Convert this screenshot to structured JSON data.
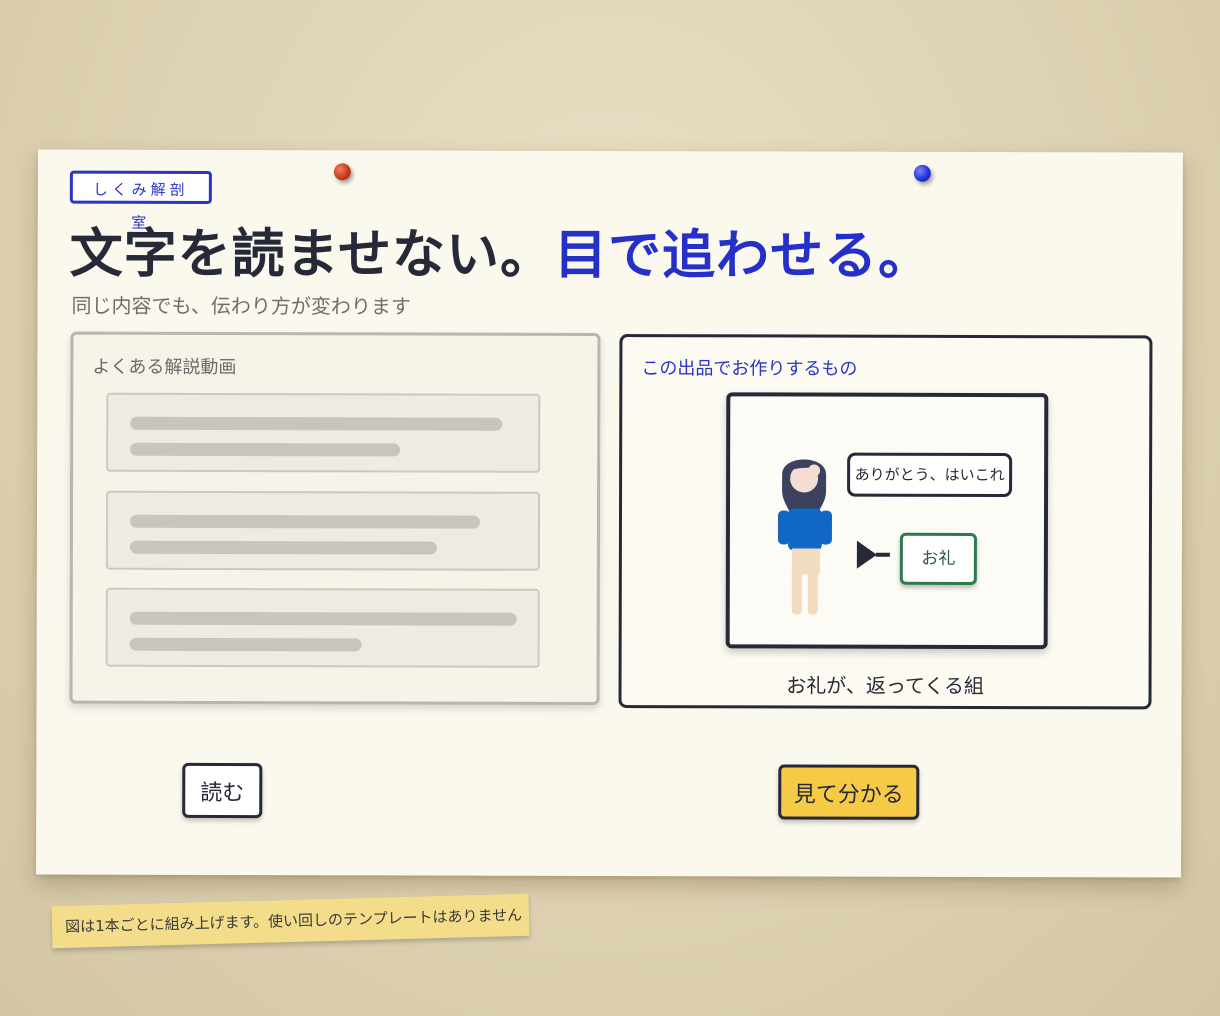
{
  "tag": "しくみ解剖室",
  "headline": {
    "main": "文字を読ませない。",
    "accent": "目で追わせる。"
  },
  "subtitle": "同じ内容でも、伝わり方が変わります",
  "left_panel": {
    "label": "よくある解説動画",
    "cards_count": 3
  },
  "right_panel": {
    "label": "この出品でお作りするもの",
    "speech_bubble": "ありがとう、はいこれ",
    "thanks_card": "お礼",
    "caption": "お礼が、返ってくる組"
  },
  "buttons": {
    "read": "読む",
    "see": "見て分かる"
  },
  "note": "図は1本ごとに組み上げます。使い回しのテンプレートはありません",
  "colors": {
    "accent_blue": "#2430c8",
    "button_yellow": "#f6c946",
    "thanks_green": "#2f7a4c",
    "ink": "#262a38"
  },
  "icons": [
    "pushpin-red",
    "pushpin-blue",
    "person-figure",
    "arrow-right"
  ]
}
